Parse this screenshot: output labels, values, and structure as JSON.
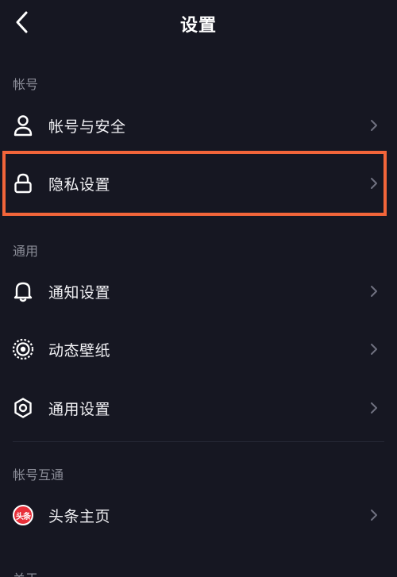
{
  "header": {
    "title": "设置",
    "back_icon": "chevron-left-icon"
  },
  "sections": [
    {
      "title": "帐号",
      "items": [
        {
          "label": "帐号与安全",
          "icon": "user-icon"
        },
        {
          "label": "隐私设置",
          "icon": "lock-icon",
          "highlighted": true
        }
      ]
    },
    {
      "title": "通用",
      "items": [
        {
          "label": "通知设置",
          "icon": "bell-icon"
        },
        {
          "label": "动态壁纸",
          "icon": "wallpaper-icon"
        },
        {
          "label": "通用设置",
          "icon": "gear-icon"
        }
      ]
    },
    {
      "title": "帐号互通",
      "items": [
        {
          "label": "头条主页",
          "icon": "toutiao-logo-icon",
          "badge_text": "头条"
        }
      ]
    },
    {
      "title": "关于"
    }
  ],
  "colors": {
    "background": "#161722",
    "highlight_border": "#f2653a",
    "section_title": "#8b8d98",
    "toutiao_red": "#e8303a"
  }
}
